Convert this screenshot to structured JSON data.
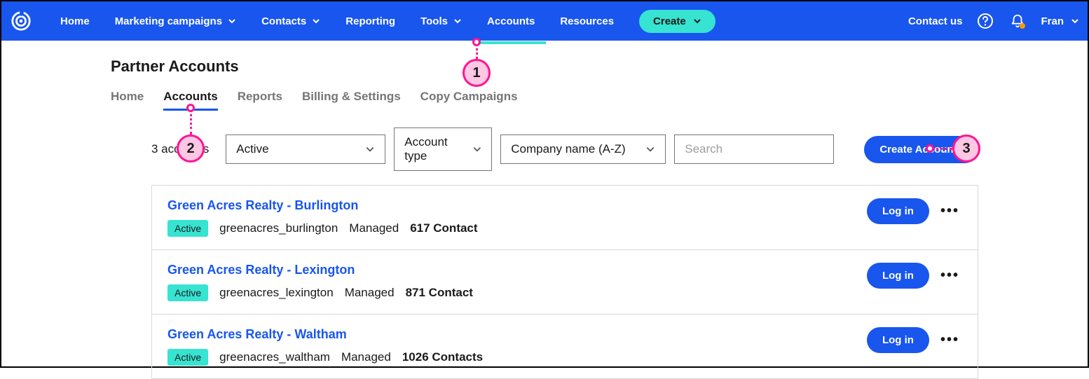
{
  "nav": {
    "items": [
      "Home",
      "Marketing campaigns",
      "Contacts",
      "Reporting",
      "Tools",
      "Accounts",
      "Resources"
    ],
    "create": "Create",
    "contact_us": "Contact us",
    "user": "Fran"
  },
  "page": {
    "title": "Partner Accounts"
  },
  "subtabs": [
    "Home",
    "Accounts",
    "Reports",
    "Billing & Settings",
    "Copy Campaigns"
  ],
  "toolbar": {
    "count": "3 accounts",
    "status": "Active",
    "type": "Account type",
    "sort": "Company name (A-Z)",
    "search_placeholder": "Search",
    "create_btn": "Create Accounts"
  },
  "accounts": [
    {
      "name": "Green Acres Realty - Burlington",
      "status": "Active",
      "slug": "greenacres_burlington",
      "managed": "Managed",
      "contacts": "617 Contact",
      "login": "Log in"
    },
    {
      "name": "Green Acres Realty - Lexington",
      "status": "Active",
      "slug": "greenacres_lexington",
      "managed": "Managed",
      "contacts": "871 Contact",
      "login": "Log in"
    },
    {
      "name": "Green Acres Realty - Waltham",
      "status": "Active",
      "slug": "greenacres_waltham",
      "managed": "Managed",
      "contacts": "1026 Contacts",
      "login": "Log in"
    }
  ],
  "callouts": [
    "1",
    "2",
    "3"
  ]
}
